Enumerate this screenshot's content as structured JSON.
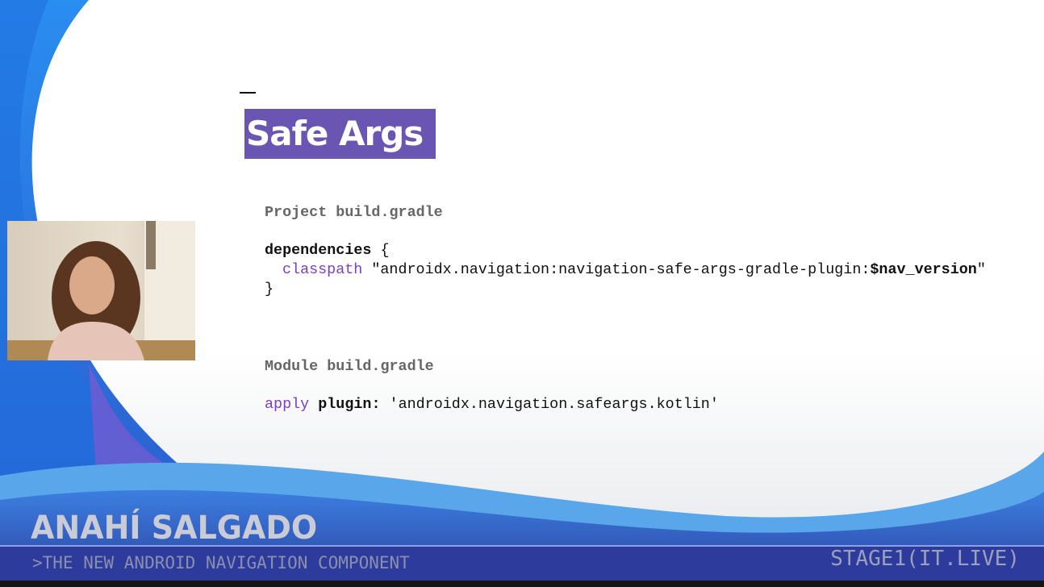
{
  "slide": {
    "title": "Safe Args",
    "project_label": "Project build.gradle",
    "dependencies_kw": "dependencies",
    "open_brace": " {",
    "classpath_kw": "classpath",
    "classpath_str": " \"androidx.navigation:navigation-safe-args-gradle-plugin:",
    "nav_version": "$nav_version",
    "close_quote": "\"",
    "close_brace": "}",
    "module_label": "Module build.gradle",
    "apply_kw": "apply",
    "plugin_kw": "plugin:",
    "plugin_str": " 'androidx.navigation.safeargs.kotlin'"
  },
  "lower_third": {
    "speaker_name": "ANAHÍ SALGADO",
    "talk_title": ">THE NEW ANDROID NAVIGATION COMPONENT",
    "stage": "STAGE1(IT.LIVE)"
  },
  "colors": {
    "title_bg": "#6a55b2",
    "bar": "#2e3a9e",
    "wave": "#2f6fd6"
  }
}
